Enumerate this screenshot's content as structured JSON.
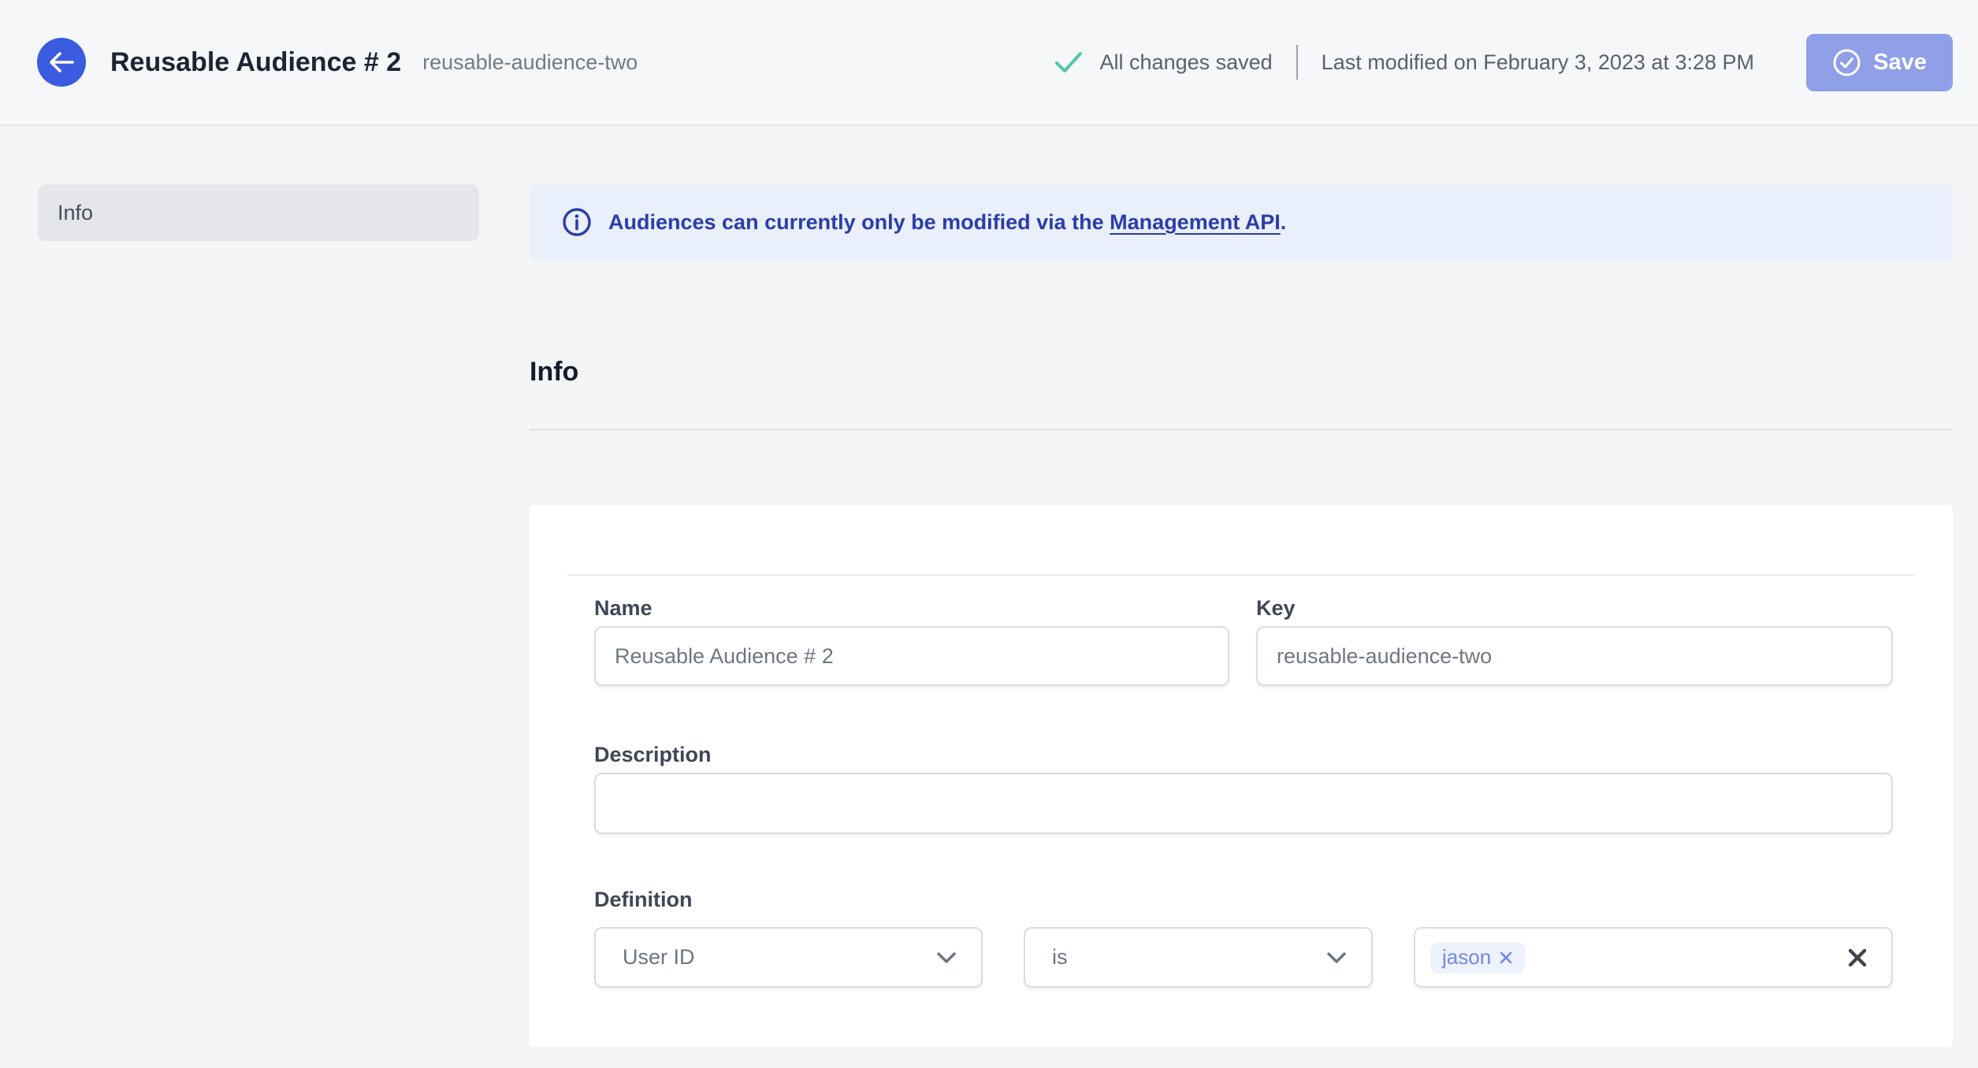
{
  "header": {
    "title": "Reusable Audience # 2",
    "slug": "reusable-audience-two",
    "status": "All changes saved",
    "last_modified": "Last modified on February 3, 2023 at 3:28 PM",
    "save_label": "Save"
  },
  "sidebar": {
    "items": [
      {
        "label": "Info"
      }
    ]
  },
  "banner": {
    "text_before": "Audiences can currently only be modified via the ",
    "link_text": "Management API",
    "text_after": "."
  },
  "main": {
    "section_title": "Info",
    "form": {
      "name": {
        "label": "Name",
        "value": "Reusable Audience # 2"
      },
      "key": {
        "label": "Key",
        "value": "reusable-audience-two"
      },
      "description": {
        "label": "Description",
        "value": ""
      },
      "definition": {
        "label": "Definition",
        "trait": "User ID",
        "operator": "is",
        "tags": [
          "jason"
        ]
      }
    }
  },
  "icons": {
    "back": "arrow-left-icon",
    "saved": "check-icon",
    "save": "circle-check-icon",
    "banner": "info-circle-icon",
    "selects": "chevron-down-icon",
    "chip_remove": "x-icon",
    "clear_values": "x-icon"
  },
  "colors": {
    "accent_blue": "#3a5ce0",
    "save_button_bg": "#8f9fe8",
    "banner_bg": "#e9effb",
    "banner_text": "#2b3dab",
    "check_green": "#50c8ac",
    "page_bg": "#f4f5f7",
    "chip_bg": "#edf2fc",
    "chip_text": "#7388e8"
  }
}
